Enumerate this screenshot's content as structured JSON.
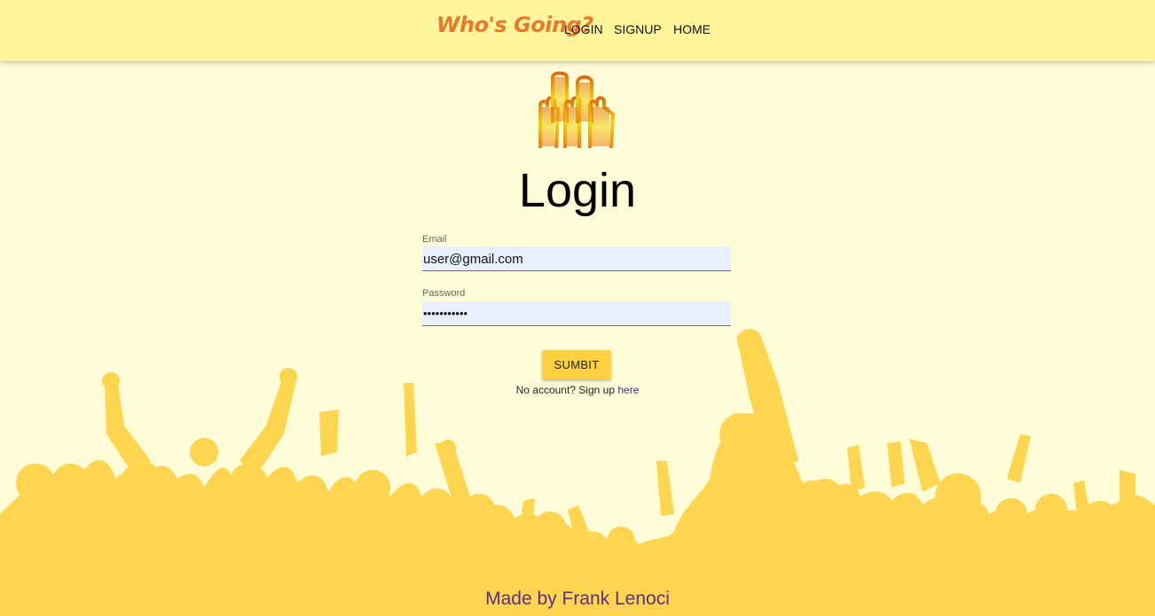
{
  "nav": {
    "brand": "Who's Going?",
    "links": [
      "LOGIN",
      "SIGNUP",
      "HOME"
    ]
  },
  "page": {
    "title": "Login",
    "logo_icon": "raised-hands-logo"
  },
  "form": {
    "email_label": "Email",
    "email_value": "user@gmail.com",
    "password_label": "Password",
    "password_value": "•••••••••••",
    "submit_label": "SUMBIT",
    "signup_text": "No account? Sign up",
    "signup_link": "here"
  },
  "footer": {
    "text": "Made by Frank Lenoci"
  },
  "colors": {
    "navbar": "#fff59d",
    "background": "#fffdd8",
    "crowd": "#ffd54f",
    "brand": "#e8782a",
    "button": "#fdd13f",
    "footer_text": "#5a2e8c"
  }
}
